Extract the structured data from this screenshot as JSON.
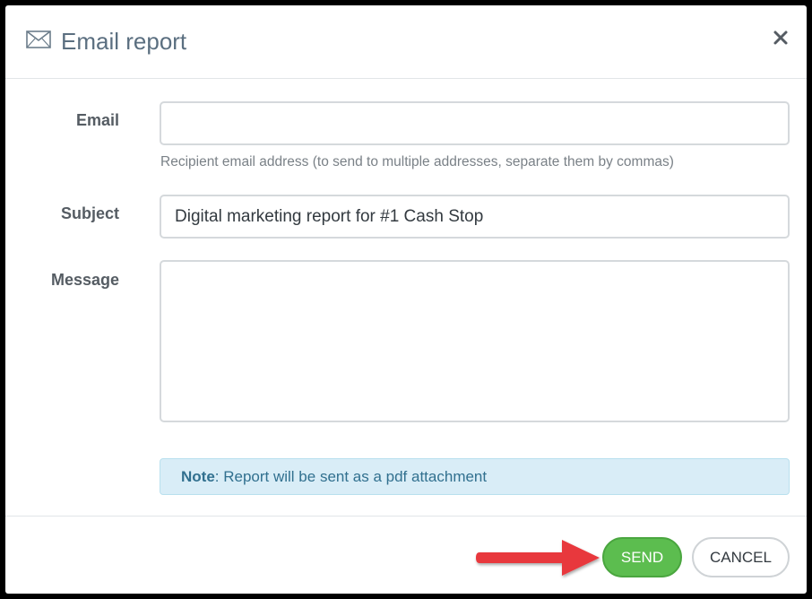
{
  "dialog": {
    "title": "Email report",
    "close_label": "×"
  },
  "form": {
    "email": {
      "label": "Email",
      "value": "",
      "placeholder": "",
      "help": "Recipient email address (to send to multiple addresses, separate them by commas)"
    },
    "subject": {
      "label": "Subject",
      "value": "Digital marketing report for #1 Cash Stop"
    },
    "message": {
      "label": "Message",
      "value": ""
    }
  },
  "note": {
    "prefix": "Note",
    "text": ": Report will be sent as a pdf attachment"
  },
  "footer": {
    "send_label": "SEND",
    "cancel_label": "CANCEL"
  },
  "colors": {
    "send_button": "#5cbd4f",
    "note_background": "#d9edf7",
    "note_text": "#31708f",
    "arrow": "#e8383d"
  },
  "icons": {
    "header": "envelope-icon",
    "close": "close-icon",
    "pointer": "red-arrow-icon"
  }
}
